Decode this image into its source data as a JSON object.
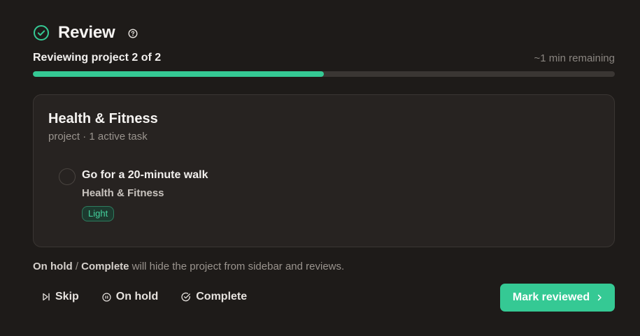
{
  "header": {
    "title": "Review",
    "icon": "check-circle-icon",
    "help_icon": "help-circle-icon"
  },
  "progress": {
    "label": "Reviewing project 2 of 2",
    "time_remaining": "~1 min remaining",
    "fraction": 0.5,
    "color": "#35c994"
  },
  "card": {
    "title": "Health & Fitness",
    "subtitle": "project · 1 active task",
    "tasks": [
      {
        "title": "Go for a 20-minute walk",
        "project": "Health & Fitness",
        "badge": "Light"
      }
    ]
  },
  "hint": {
    "on_hold": "On hold",
    "separator": " / ",
    "complete": "Complete",
    "rest": " will hide the project from sidebar and reviews."
  },
  "actions": {
    "skip": "Skip",
    "on_hold": "On hold",
    "complete": "Complete",
    "mark_reviewed": "Mark reviewed"
  },
  "colors": {
    "accent": "#35c994",
    "background": "#1e1b19",
    "card": "#272321"
  }
}
